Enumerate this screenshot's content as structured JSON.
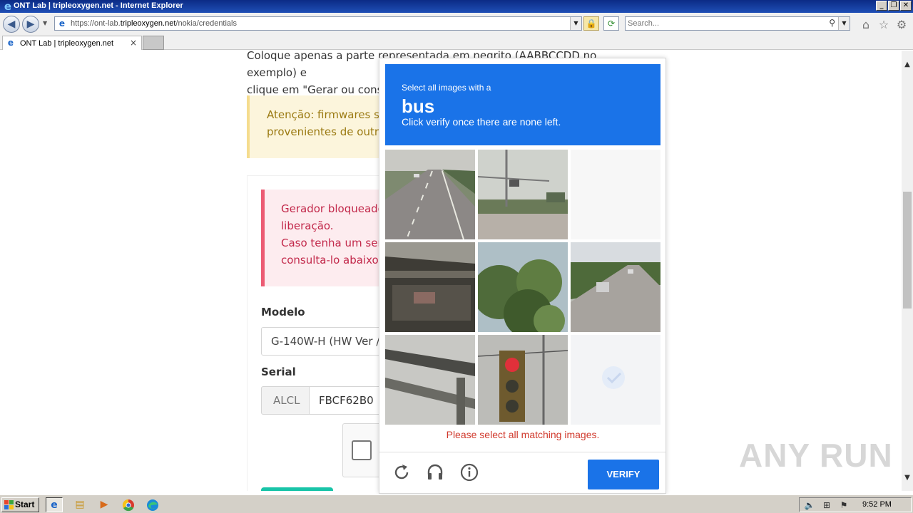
{
  "window": {
    "title": "ONT Lab | tripleoxygen.net - Internet Explorer",
    "minimize_glyph": "_",
    "restore_glyph": "❐",
    "close_glyph": "✕"
  },
  "address_bar": {
    "url_prefix": "https://ont-lab.",
    "url_domain": "tripleoxygen.net",
    "url_path": "/nokia/credentials",
    "search_placeholder": "Search..."
  },
  "tabs": [
    {
      "label": "ONT Lab | tripleoxygen.net",
      "close": "×"
    }
  ],
  "page": {
    "instruction_lines": [
      "Coloque apenas a parte representada em negrito (AABBCCDD no exemplo) e",
      "clique em \"Gerar ou consu"
    ],
    "warning_lines": [
      "Atenção: firmwares ser",
      "provenientes de outro"
    ],
    "alert_lines": [
      "Gerador bloqueado",
      "liberação.",
      "Caso tenha um seria",
      "consulta-lo abaixo s"
    ],
    "model_label": "Modelo",
    "model_value": "G-140W-H (HW Ver /",
    "serial_label": "Serial",
    "serial_prefix": "ALCL",
    "serial_value": "FBCF62B0"
  },
  "captcha": {
    "prompt_line1": "Select all images with a",
    "target": "bus",
    "prompt_line3": "Click verify once there are none left.",
    "error": "Please select all matching images.",
    "verify_label": "VERIFY",
    "colors": {
      "header": "#1a73e8",
      "error": "#d0382b",
      "button": "#1a73e8"
    },
    "tiles": [
      {
        "content": "road with cars",
        "state": "shown"
      },
      {
        "content": "traffic light intersection",
        "state": "shown"
      },
      {
        "content": "blank (faded)",
        "state": "fading"
      },
      {
        "content": "bridge underside",
        "state": "shown"
      },
      {
        "content": "palm trees",
        "state": "shown"
      },
      {
        "content": "highway with car",
        "state": "shown"
      },
      {
        "content": "overpass beam",
        "state": "shown"
      },
      {
        "content": "traffic light red",
        "state": "shown"
      },
      {
        "content": "faded selected",
        "state": "fading"
      }
    ]
  },
  "watermark": "ANY RUN",
  "taskbar": {
    "start_label": "Start",
    "clock": "9:52 PM"
  }
}
